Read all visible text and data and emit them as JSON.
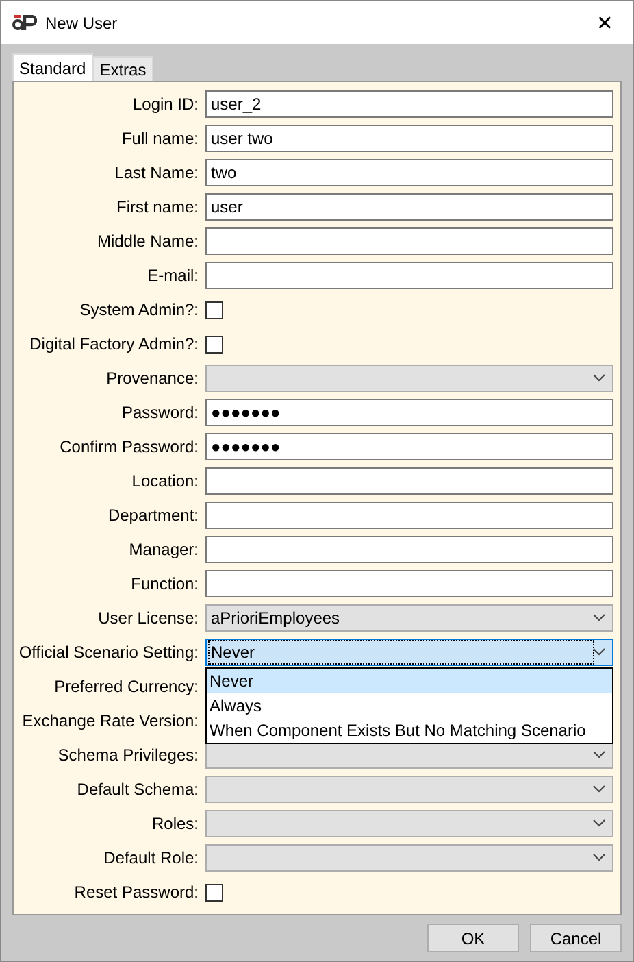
{
  "window": {
    "title": "New User",
    "close": "✕"
  },
  "tabs": [
    {
      "label": "Standard",
      "selected": true
    },
    {
      "label": "Extras",
      "selected": false
    }
  ],
  "fields": [
    {
      "label": "Login ID:",
      "kind": "text",
      "value": "user_2"
    },
    {
      "label": "Full name:",
      "kind": "text",
      "value": "user two"
    },
    {
      "label": "Last Name:",
      "kind": "text",
      "value": "two"
    },
    {
      "label": "First name:",
      "kind": "text",
      "value": "user"
    },
    {
      "label": "Middle Name:",
      "kind": "text"
    },
    {
      "label": "E-mail:",
      "kind": "text"
    },
    {
      "label": "System Admin?:",
      "kind": "checkbox",
      "checked": false
    },
    {
      "label": "Digital Factory Admin?:",
      "kind": "checkbox",
      "checked": false
    },
    {
      "label": "Provenance:",
      "kind": "select"
    },
    {
      "label": "Password:",
      "kind": "text",
      "value": "●●●●●●●"
    },
    {
      "label": "Confirm Password:",
      "kind": "text",
      "value": "●●●●●●●"
    },
    {
      "label": "Location:",
      "kind": "text"
    },
    {
      "label": "Department:",
      "kind": "text"
    },
    {
      "label": "Manager:",
      "kind": "text"
    },
    {
      "label": "Function:",
      "kind": "text"
    },
    {
      "label": "User License:",
      "kind": "select",
      "value": "aPrioriEmployees"
    },
    {
      "label": "Official Scenario Setting:",
      "kind": "select",
      "value": "Never",
      "open": true,
      "options": [
        {
          "label": "Never",
          "selected": true
        },
        {
          "label": "Always",
          "selected": false
        },
        {
          "label": "When Component Exists But No Matching Scenario",
          "selected": false
        }
      ]
    },
    {
      "label": "Preferred Currency:",
      "kind": "covered"
    },
    {
      "label": "Exchange Rate Version:",
      "kind": "covered"
    },
    {
      "label": "Schema Privileges:",
      "kind": "select"
    },
    {
      "label": "Default Schema:",
      "kind": "select"
    },
    {
      "label": "Roles:",
      "kind": "select"
    },
    {
      "label": "Default Role:",
      "kind": "select"
    },
    {
      "label": "Reset Password:",
      "kind": "checkbox",
      "checked": false
    }
  ],
  "buttons": [
    "OK",
    "Cancel"
  ]
}
